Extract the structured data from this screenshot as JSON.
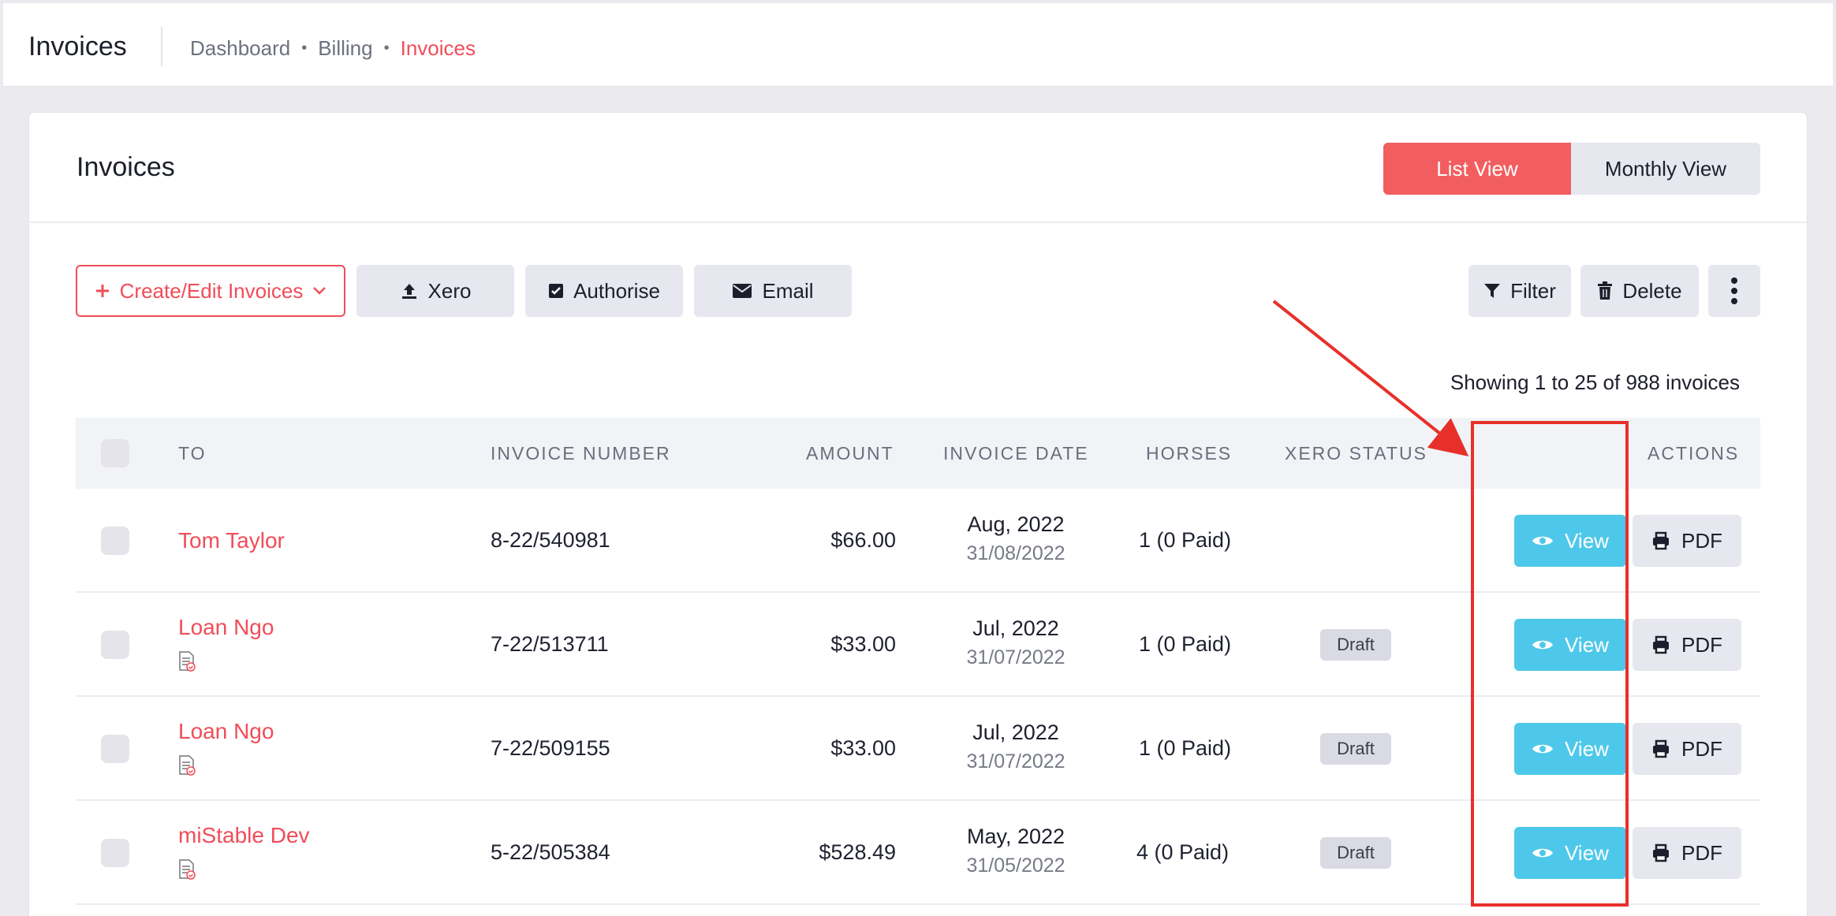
{
  "topbar": {
    "title": "Invoices",
    "breadcrumb": [
      "Dashboard",
      "Billing",
      "Invoices"
    ]
  },
  "card": {
    "title": "Invoices",
    "view_toggle": {
      "list": "List View",
      "monthly": "Monthly View"
    }
  },
  "toolbar": {
    "create": "Create/Edit Invoices",
    "xero": "Xero",
    "authorise": "Authorise",
    "email": "Email",
    "filter": "Filter",
    "delete": "Delete"
  },
  "showing": "Showing 1 to 25 of 988 invoices",
  "table": {
    "headers": {
      "to": "TO",
      "invoice_number": "INVOICE NUMBER",
      "amount": "AMOUNT",
      "invoice_date": "INVOICE DATE",
      "horses": "HORSES",
      "xero_status": "XERO STATUS",
      "actions": "ACTIONS"
    },
    "view_label": "View",
    "pdf_label": "PDF",
    "rows": [
      {
        "to": "Tom Taylor",
        "invoice_number": "8-22/540981",
        "amount": "$66.00",
        "month": "Aug, 2022",
        "date": "31/08/2022",
        "horses": "1 (0 Paid)",
        "status": ""
      },
      {
        "to": "Loan Ngo",
        "invoice_number": "7-22/513711",
        "amount": "$33.00",
        "month": "Jul, 2022",
        "date": "31/07/2022",
        "horses": "1 (0 Paid)",
        "status": "Draft"
      },
      {
        "to": "Loan Ngo",
        "invoice_number": "7-22/509155",
        "amount": "$33.00",
        "month": "Jul, 2022",
        "date": "31/07/2022",
        "horses": "1 (0 Paid)",
        "status": "Draft"
      },
      {
        "to": "miStable Dev",
        "invoice_number": "5-22/505384",
        "amount": "$528.49",
        "month": "May, 2022",
        "date": "31/05/2022",
        "horses": "4 (0 Paid)",
        "status": "Draft"
      }
    ]
  },
  "colors": {
    "accent": "#f04d5a",
    "view_button": "#4ec8ea",
    "annotation": "#e8302a"
  }
}
